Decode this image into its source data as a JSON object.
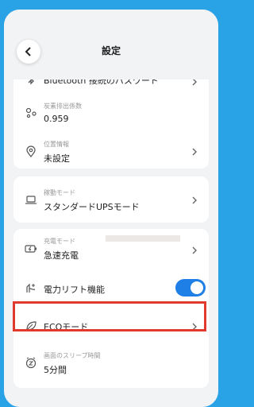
{
  "header": {
    "title": "設定"
  },
  "card1": {
    "bluetooth_label": "Bluetooth 接続のパスワード",
    "carbon": {
      "label": "炭素排出係数",
      "value": "0.959"
    },
    "location": {
      "label": "位置情報",
      "value": "未設定"
    }
  },
  "card2": {
    "operation": {
      "label": "稼動モード",
      "value": "スタンダードUPSモード"
    }
  },
  "card3": {
    "charge": {
      "label": "充電モード",
      "value": "急速充電"
    },
    "power_lift": {
      "label": "電力リフト機能",
      "enabled": true
    },
    "eco": {
      "label": "ECOモード"
    },
    "sleep": {
      "label": "画面のスリープ時間",
      "value": "5分間"
    }
  },
  "colors": {
    "accent": "#1e7fe6",
    "frame": "#2aa3e6",
    "highlight": "#e03a2f"
  }
}
